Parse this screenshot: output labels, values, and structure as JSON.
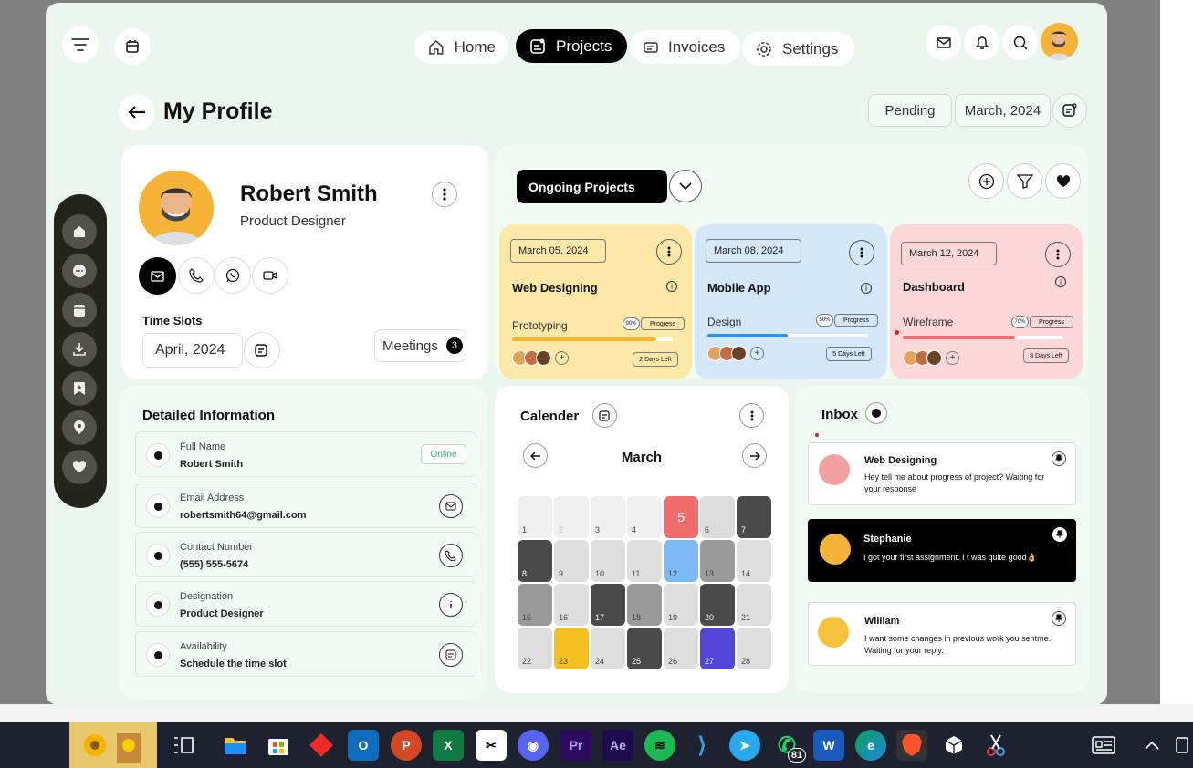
{
  "nav": {
    "home": "Home",
    "projects": "Projects",
    "invoices": "Invoices",
    "settings": "Settings"
  },
  "header": {
    "title": "My Profile",
    "status_filter": "Pending",
    "date_filter": "March, 2024"
  },
  "profile": {
    "name": "Robert Smith",
    "role": "Product Designer",
    "time_slots_label": "Time Slots",
    "time_slots_value": "April, 2024",
    "meetings_label": "Meetings",
    "meetings_count": "3"
  },
  "projects": {
    "dropdown_label": "Ongoing Projects",
    "cards": [
      {
        "date": "March 05, 2024",
        "title": "Web Designing",
        "stage": "Prototyping",
        "percent": "90%",
        "progress_label": "Progress",
        "progress_value": 0.9,
        "days_left": "2 Days Left",
        "color": "#fde8a9",
        "bar_color": "#f5b827"
      },
      {
        "date": "March 08, 2024",
        "title": "Mobile App",
        "stage": "Design",
        "percent": "50%",
        "progress_label": "Progress",
        "progress_value": 0.5,
        "days_left": "5 Days Left",
        "color": "#d4e7fb",
        "bar_color": "#2f8ef0"
      },
      {
        "date": "March 12, 2024",
        "title": "Dashboard",
        "stage": "Wireframe",
        "percent": "70%",
        "progress_label": "Progress",
        "progress_value": 0.7,
        "days_left": "8 Days Left",
        "color": "#fcd7d7",
        "bar_color": "#f06b6b"
      }
    ]
  },
  "details": {
    "title": "Detailed Information",
    "fields": [
      {
        "label": "Full Name",
        "value": "Robert Smith",
        "badge": "Online",
        "icon": "online-badge"
      },
      {
        "label": "Email Address",
        "value": "robertsmith64@gmail.com",
        "icon": "mail-icon"
      },
      {
        "label": "Contact Number",
        "value": "(555) 555-5674",
        "icon": "phone-icon"
      },
      {
        "label": "Designation",
        "value": "Product Designer",
        "icon": "info-icon"
      },
      {
        "label": "Availability",
        "value": "Schedule the time slot",
        "icon": "calendar-edit-icon"
      }
    ]
  },
  "calendar": {
    "title": "Calender",
    "month": "March",
    "days": [
      "1",
      "2",
      "3",
      "4",
      "5",
      "6",
      "7",
      "8",
      "9",
      "10",
      "11",
      "12",
      "13",
      "14",
      "15",
      "16",
      "17",
      "18",
      "19",
      "20",
      "21",
      "22",
      "23",
      "24",
      "25",
      "26",
      "27",
      "28"
    ]
  },
  "inbox": {
    "title": "Inbox",
    "messages": [
      {
        "sender": "Web Designing",
        "text": "Hey tell me about progress of project? Waiting for your response"
      },
      {
        "sender": "Stephanie",
        "text": "I got your first assignment. I t was quite good👌"
      },
      {
        "sender": "William",
        "text": "I want some changes in previous work you sentme. Waiting for your reply."
      }
    ]
  },
  "taskbar": {
    "whatsapp_badge": "81"
  },
  "colors": {
    "app_bg": "#eaf6ee",
    "accent_black": "#000000",
    "online_green": "#2bb673",
    "today_red": "#f06b6b"
  }
}
